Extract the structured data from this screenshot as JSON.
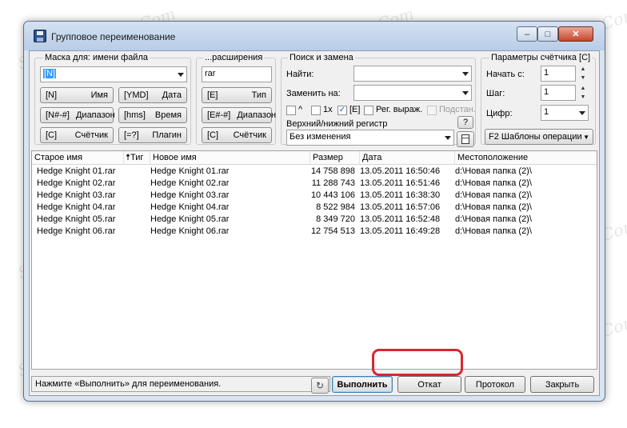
{
  "window": {
    "title": "Групповое переименование",
    "min_label": "–",
    "max_label": "□",
    "close_label": "✕",
    "icon": "floppy-disk-icon"
  },
  "mask_group": {
    "label": "Маска для: имени файла",
    "value": "[N]",
    "buttons": [
      {
        "key": "[N]",
        "text": "Имя"
      },
      {
        "key": "[YMD]",
        "text": "Дата"
      },
      {
        "key": "[N#-#]",
        "text": "Диапазон"
      },
      {
        "key": "[hms]",
        "text": "Время"
      },
      {
        "key": "[C]",
        "text": "Счётчик"
      },
      {
        "key": "[=?]",
        "text": "Плагин"
      }
    ]
  },
  "ext_group": {
    "label": "...расширения",
    "value": "rar",
    "buttons": [
      {
        "key": "[E]",
        "text": "Тип"
      },
      {
        "key": "[E#-#]",
        "text": "Диапазон"
      },
      {
        "key": "[C]",
        "text": "Счётчик"
      }
    ]
  },
  "search_group": {
    "label": "Поиск и замена",
    "find_label": "Найти:",
    "find_value": "",
    "replace_label": "Заменить на:",
    "replace_value": "",
    "caret_label": "^",
    "once_label": "1x",
    "ext_label": "[E]",
    "ext_checked": "✓",
    "regex_label": "Рег. выраж.",
    "subst_label": "Подстан.",
    "case_label": "Верхний/нижний регистр",
    "case_value": "Без изменения",
    "help_label": "?"
  },
  "counter_group": {
    "label": "Параметры счётчика [C]",
    "start_label": "Начать с:",
    "start_value": "1",
    "step_label": "Шаг:",
    "step_value": "1",
    "digits_label": "Цифр:",
    "digits_value": "1",
    "templates_label": "F2 Шаблоны операции"
  },
  "file_list": {
    "columns": [
      "Старое имя",
      "Тиг",
      "Новое имя",
      "Размер",
      "Дата",
      "Местоположение"
    ],
    "sort_arrow": "🠅",
    "rows": [
      {
        "old": "Hedge Knight 01.rar",
        "new": "Hedge Knight 01.rar",
        "size": "14 758 898",
        "date": "13.05.2011 16:50:46",
        "path": "d:\\Новая папка (2)\\"
      },
      {
        "old": "Hedge Knight 02.rar",
        "new": "Hedge Knight 02.rar",
        "size": "11 288 743",
        "date": "13.05.2011 16:51:46",
        "path": "d:\\Новая папка (2)\\"
      },
      {
        "old": "Hedge Knight 03.rar",
        "new": "Hedge Knight 03.rar",
        "size": "10 443 106",
        "date": "13.05.2011 16:38:30",
        "path": "d:\\Новая папка (2)\\"
      },
      {
        "old": "Hedge Knight 04.rar",
        "new": "Hedge Knight 04.rar",
        "size": "8 522 984",
        "date": "13.05.2011 16:57:06",
        "path": "d:\\Новая папка (2)\\"
      },
      {
        "old": "Hedge Knight 05.rar",
        "new": "Hedge Knight 05.rar",
        "size": "8 349 720",
        "date": "13.05.2011 16:52:48",
        "path": "d:\\Новая папка (2)\\"
      },
      {
        "old": "Hedge Knight 06.rar",
        "new": "Hedge Knight 06.rar",
        "size": "12 754 513",
        "date": "13.05.2011 16:49:28",
        "path": "d:\\Новая папка (2)\\"
      }
    ]
  },
  "status": {
    "text": "Нажмите «Выполнить» для переименования."
  },
  "actions": {
    "redo_icon": "↻",
    "execute": "Выполнить",
    "rollback": "Откат",
    "log": "Протокол",
    "close": "Закрыть"
  },
  "watermark": "Sovingpcrepair.Com",
  "colors": {
    "highlight": "#d8272d",
    "selection": "#3399ff"
  }
}
